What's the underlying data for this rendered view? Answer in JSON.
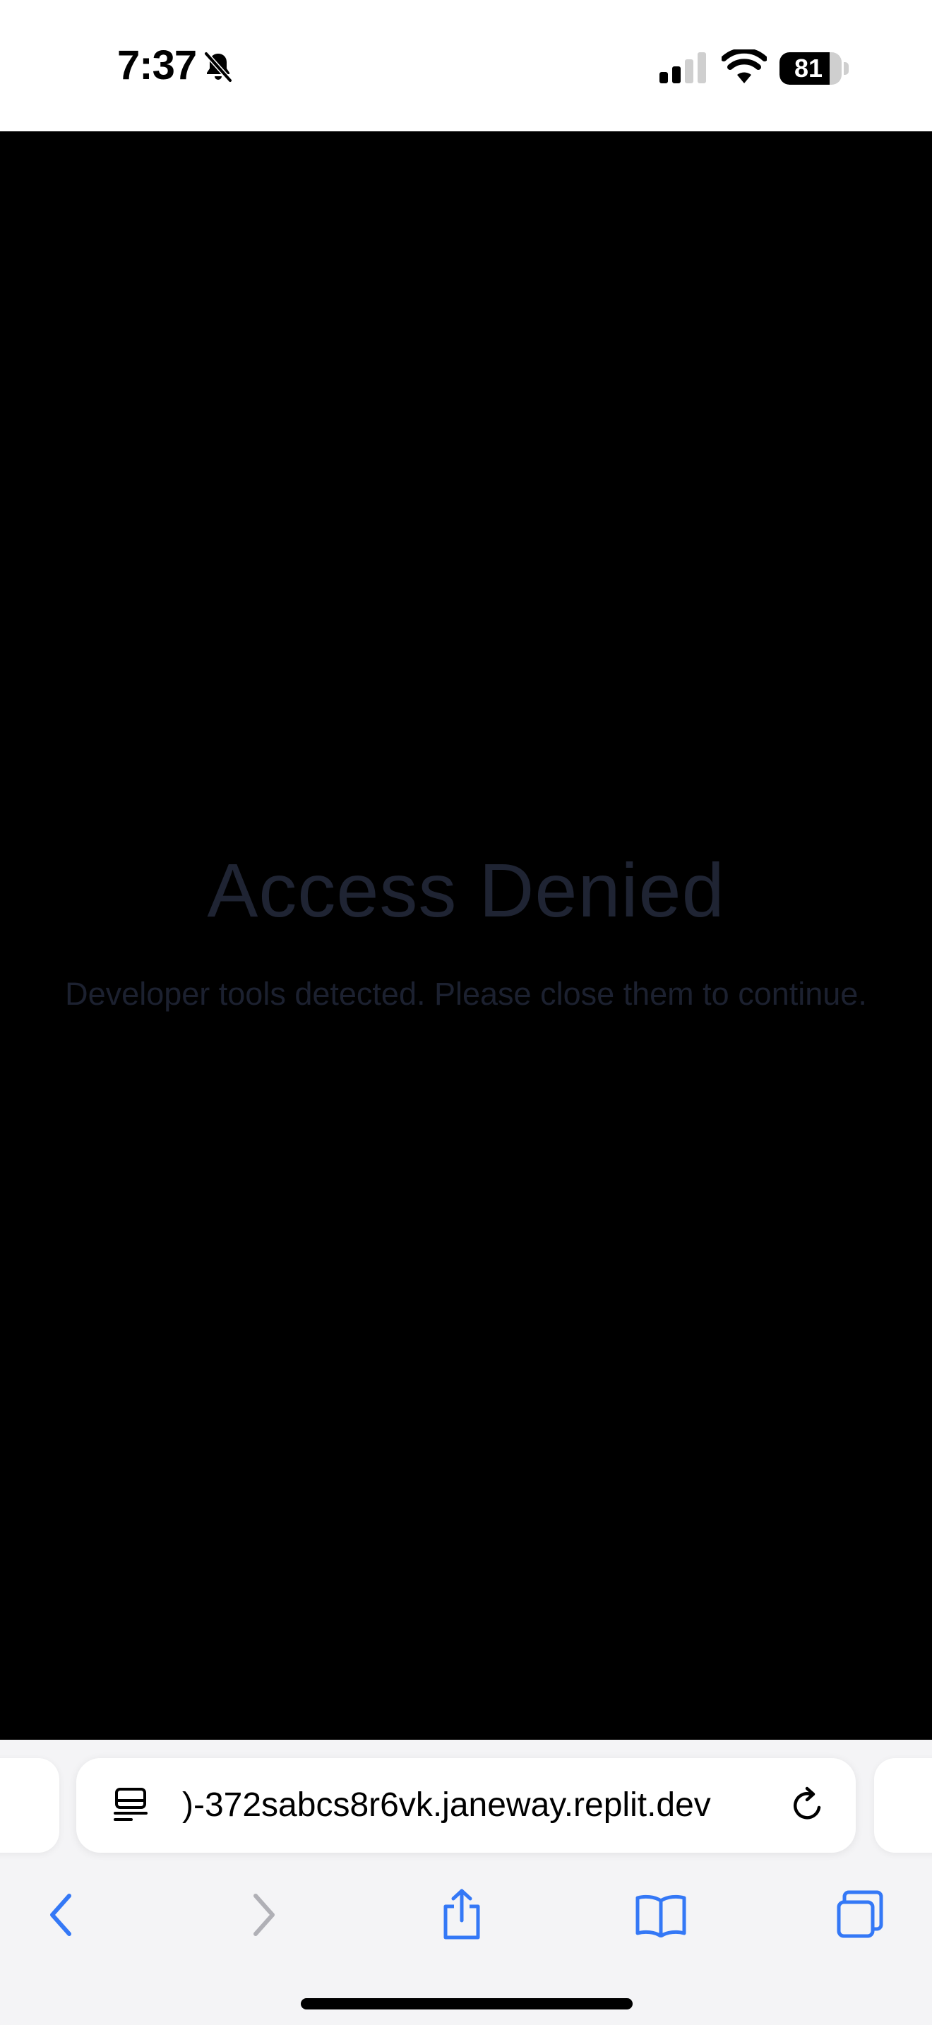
{
  "status_bar": {
    "time": "7:37",
    "battery_level": "81",
    "battery_fraction": 0.81
  },
  "page": {
    "title": "Access Denied",
    "message": "Developer tools detected. Please close them to continue."
  },
  "browser": {
    "url": ")-372sabcs8r6vk.janeway.replit.dev",
    "accent_color": "#3478f6",
    "disabled_color": "#b0b0b6"
  },
  "icons": {
    "silent": "bell-slash-icon",
    "signal": "cellular-signal-icon",
    "wifi": "wifi-icon",
    "page_menu": "page-menu-icon",
    "reload": "reload-icon",
    "back": "chevron-left-icon",
    "forward": "chevron-right-icon",
    "share": "share-icon",
    "bookmarks": "book-icon",
    "tabs": "tabs-icon"
  }
}
